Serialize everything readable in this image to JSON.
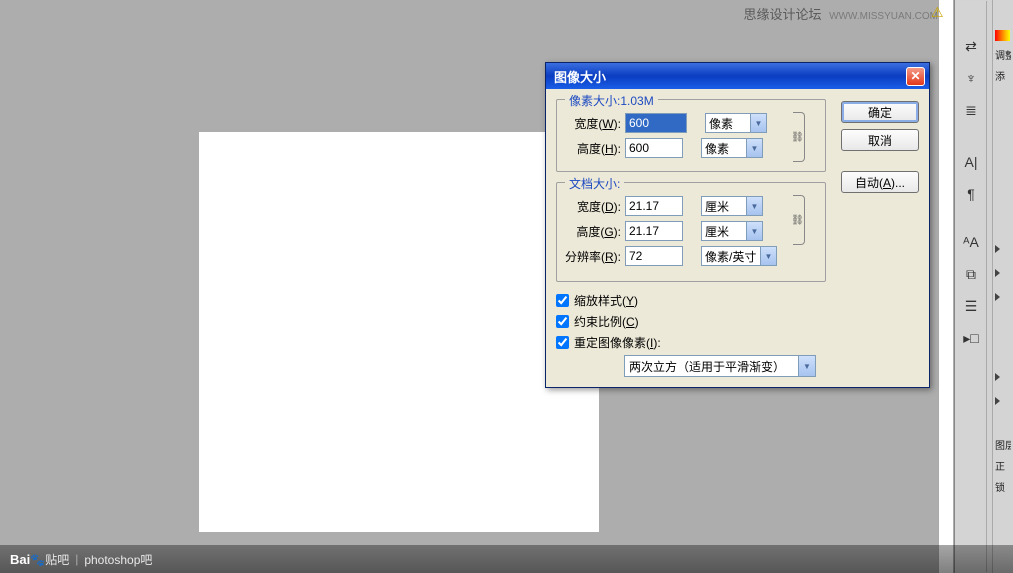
{
  "watermark": {
    "cn": "思缘设计论坛",
    "en": "WWW.MISSYUAN.COM"
  },
  "dialog": {
    "title": "图像大小",
    "pixel_size_label": "像素大小:1.03M",
    "doc_size_label": "文档大小:",
    "width_label_w": "宽度(",
    "width_key_w": "W",
    "label_close": "):",
    "height_label_h": "高度(",
    "height_key_h": "H",
    "width_label_d": "宽度(",
    "width_key_d": "D",
    "height_label_g": "高度(",
    "height_key_g": "G",
    "res_label": "分辨率(",
    "res_key": "R",
    "px_width": "600",
    "px_height": "600",
    "px_unit": "像素",
    "doc_width": "21.17",
    "doc_height": "21.17",
    "doc_unit": "厘米",
    "resolution": "72",
    "res_unit": "像素/英寸",
    "chk_scale": "缩放样式(",
    "chk_scale_key": "Y",
    "chk_scale_close": ")",
    "chk_constrain": "约束比例(",
    "chk_constrain_key": "C",
    "chk_constrain_close": ")",
    "chk_resample": "重定图像像素(",
    "chk_resample_key": "I",
    "chk_resample_close": "):",
    "resample_method": "两次立方（适用于平滑渐变）",
    "ok": "确定",
    "cancel": "取消",
    "auto": "自动(",
    "auto_key": "A",
    "auto_close": ")..."
  },
  "footer": {
    "logo1": "Bai",
    "logo2": "贴吧",
    "page": "photoshop吧"
  },
  "rightpanel": {
    "adjust": "调整",
    "add": "添",
    "layers": "图层",
    "normal": "正",
    "lock": "锁"
  }
}
